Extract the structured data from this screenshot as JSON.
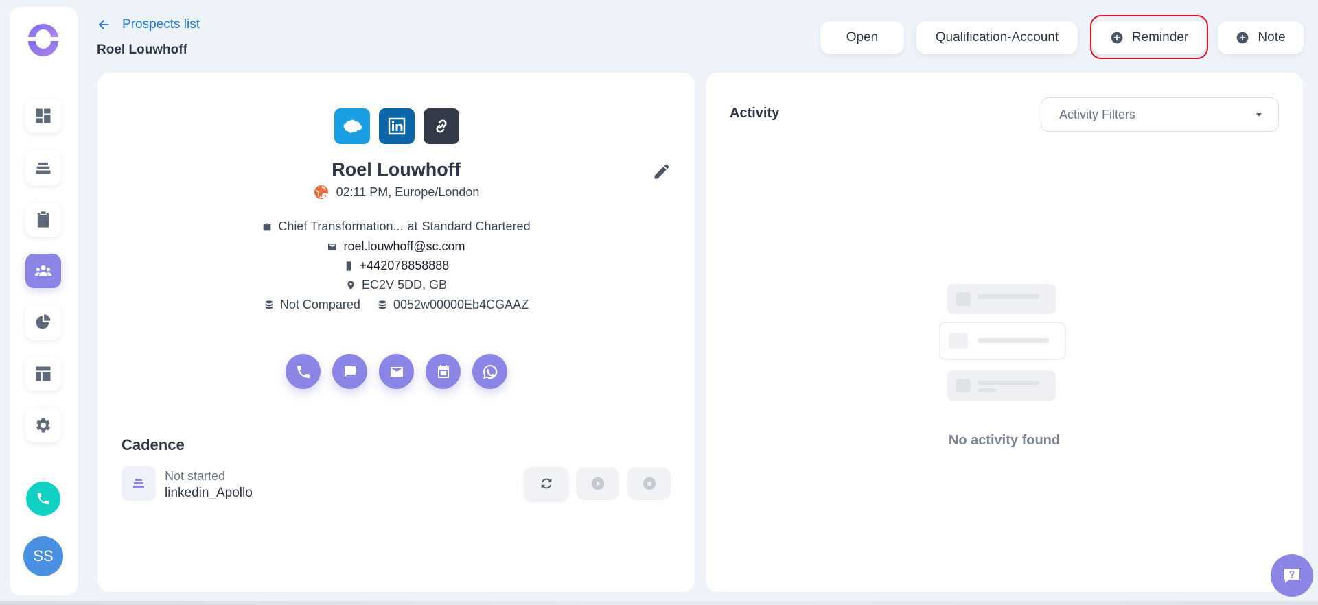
{
  "header": {
    "back_label": "Prospects list",
    "title": "Roel Louwhoff",
    "buttons": [
      {
        "label": "Open"
      },
      {
        "label": "Qualification-Account"
      },
      {
        "label": "Reminder",
        "icon": "plus-circle-icon"
      },
      {
        "label": "Note",
        "icon": "plus-circle-icon"
      }
    ]
  },
  "sidebar": {
    "items": [
      {
        "name": "dashboard-icon"
      },
      {
        "name": "cadence-icon"
      },
      {
        "name": "tasks-icon"
      },
      {
        "name": "people-icon",
        "active": true
      },
      {
        "name": "reports-icon"
      },
      {
        "name": "templates-icon"
      },
      {
        "name": "settings-icon"
      }
    ],
    "avatar_initials": "SS"
  },
  "prospect": {
    "name": "Roel Louwhoff",
    "time": "02:11 PM, Europe/London",
    "job": "Chief Transformation...",
    "at": "at",
    "company": "Standard Chartered",
    "email": "roel.louwhoff@sc.com",
    "phone": "+442078858888",
    "location": "EC2V 5DD, GB",
    "compare_status": "Not Compared",
    "record_id": "0052w00000Eb4CGAAZ"
  },
  "cadence": {
    "title": "Cadence",
    "status": "Not started",
    "name": "linkedin_Apollo"
  },
  "activity": {
    "title": "Activity",
    "filter_placeholder": "Activity Filters",
    "empty_text": "No activity found"
  },
  "colors": {
    "accent": "#8b86e6",
    "link": "#1f7ae0",
    "highlight": "#e0152b",
    "call": "#10d1c4"
  }
}
